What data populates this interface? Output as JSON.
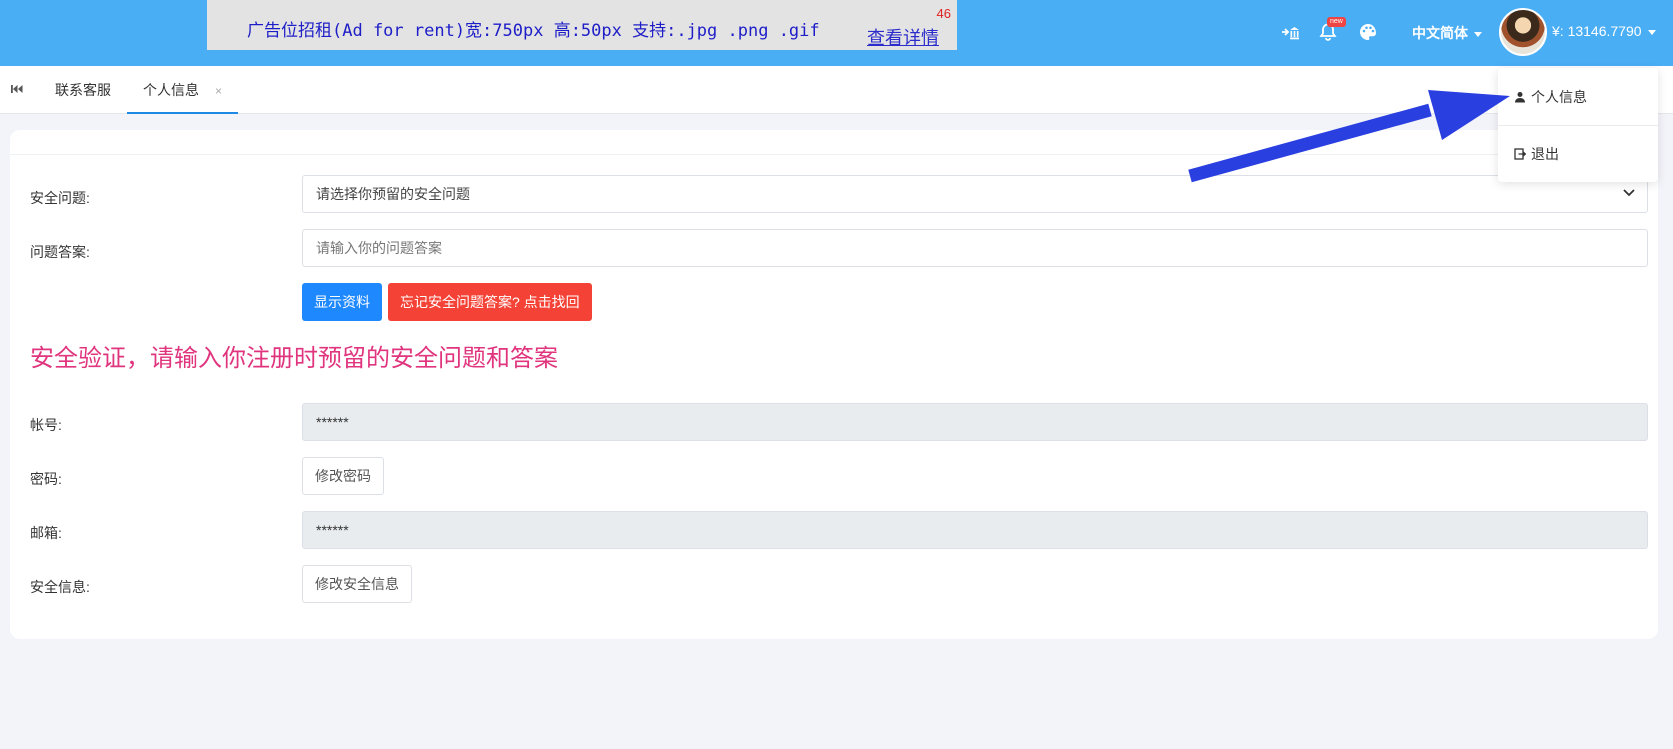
{
  "header": {
    "ad": {
      "text": "广告位招租(Ad for rent)宽:750px 高:50px 支持:.jpg .png .gif",
      "link": "查看详情",
      "count": "46"
    },
    "icons": [
      "bank-transfer-icon",
      "bell-icon",
      "palette-icon"
    ],
    "badge": "new",
    "language": "中文简体",
    "balance": "¥: 13146.7790"
  },
  "tabs": {
    "items": [
      {
        "label": "联系客服",
        "active": false
      },
      {
        "label": "个人信息",
        "active": true
      }
    ],
    "close_symbol": "×"
  },
  "form": {
    "security_question": {
      "label": "安全问题:",
      "placeholder": "请选择你预留的安全问题"
    },
    "answer": {
      "label": "问题答案:",
      "placeholder": "请输入你的问题答案"
    },
    "buttons": {
      "show": "显示资料",
      "forgot": "忘记安全问题答案? 点击找回"
    },
    "notice": "安全验证，请输入你注册时预留的安全问题和答案",
    "account": {
      "label": "帐号:",
      "value": "******"
    },
    "password": {
      "label": "密码:",
      "button": "修改密码"
    },
    "email": {
      "label": "邮箱:",
      "value": "******"
    },
    "security_info": {
      "label": "安全信息:",
      "button": "修改安全信息"
    }
  },
  "dropdown": {
    "items": [
      {
        "label": "个人信息",
        "icon": "user-icon"
      },
      {
        "label": "退出",
        "icon": "logout-icon"
      }
    ]
  },
  "colors": {
    "header": "#4aaef5",
    "primary": "#1e88ff",
    "danger": "#f44336",
    "notice": "#e0357e",
    "arrow": "#2a3fe0"
  }
}
